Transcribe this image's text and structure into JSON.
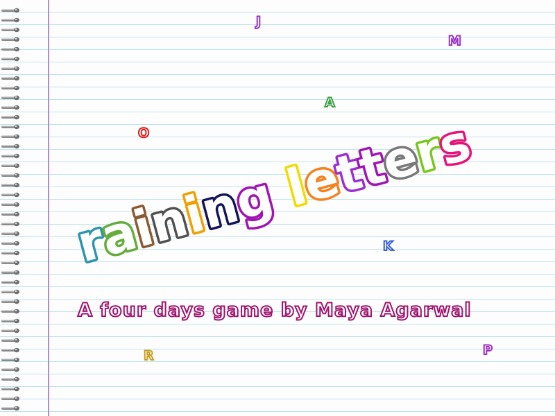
{
  "title": {
    "text": "raining letters",
    "letter_colors": [
      "#2d95ad",
      "#64ad3c",
      "#8c5a32",
      "#505050",
      "#f0a000",
      "#14145a",
      "#a014b4",
      "#e60000",
      "#f0dc00",
      "#f5821e",
      "#9b30d2",
      "#a014b4",
      "#787878",
      "#78c81e",
      "#e6147a"
    ]
  },
  "subtitle": {
    "text": "A four days game  by  Maya Agarwal",
    "color": "#a0126e"
  },
  "falling_letters": [
    {
      "char": "J",
      "color": "#9b30c8"
    },
    {
      "char": "M",
      "color": "#9b30c8"
    },
    {
      "char": "A",
      "color": "#3aa040"
    },
    {
      "char": "O",
      "color": "#e01a1a"
    },
    {
      "char": "K",
      "color": "#3a60d0"
    },
    {
      "char": "R",
      "color": "#c8a020"
    },
    {
      "char": "P",
      "color": "#a030c0"
    }
  ],
  "notebook": {
    "rule_color": "#bfe3ee",
    "margin_color": "#b48ac8"
  }
}
